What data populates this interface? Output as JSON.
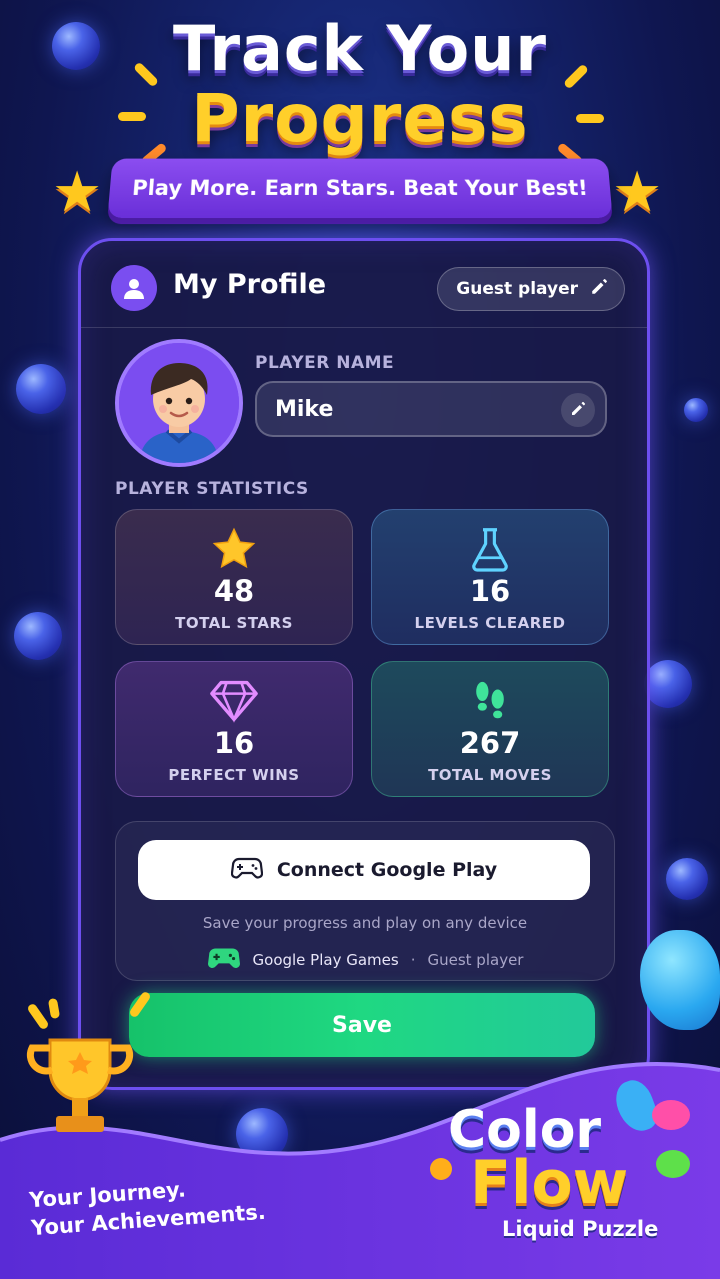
{
  "header": {
    "title_line1": "Track Your",
    "title_line2": "Progress",
    "ribbon": "Play More. Earn Stars. Beat Your Best!"
  },
  "profile": {
    "title": "My Profile",
    "status_chip": "Guest player",
    "name_label": "PLAYER NAME",
    "name_value": "Mike",
    "stats_label": "PLAYER STATISTICS"
  },
  "stats": [
    {
      "value": "48",
      "label": "TOTAL STARS",
      "icon": "star-icon"
    },
    {
      "value": "16",
      "label": "LEVELS CLEARED",
      "icon": "flask-icon"
    },
    {
      "value": "16",
      "label": "PERFECT WINS",
      "icon": "diamond-icon"
    },
    {
      "value": "267",
      "label": "TOTAL MOVES",
      "icon": "footprints-icon"
    }
  ],
  "google_play": {
    "button_label": "Connect Google Play",
    "subtitle": "Save your progress and play on any device",
    "service_name": "Google Play Games",
    "separator": "·",
    "status": "Guest player"
  },
  "save_label": "Save",
  "footer": {
    "tagline_1": "Your Journey.",
    "tagline_2": "Your Achievements.",
    "logo_line1": "Color",
    "logo_line2": "Flow",
    "logo_sub": "Liquid Puzzle"
  },
  "colors": {
    "accent_purple": "#7a4ef0",
    "save_green": "#1fd882",
    "title_yellow": "#ffcf2a"
  }
}
